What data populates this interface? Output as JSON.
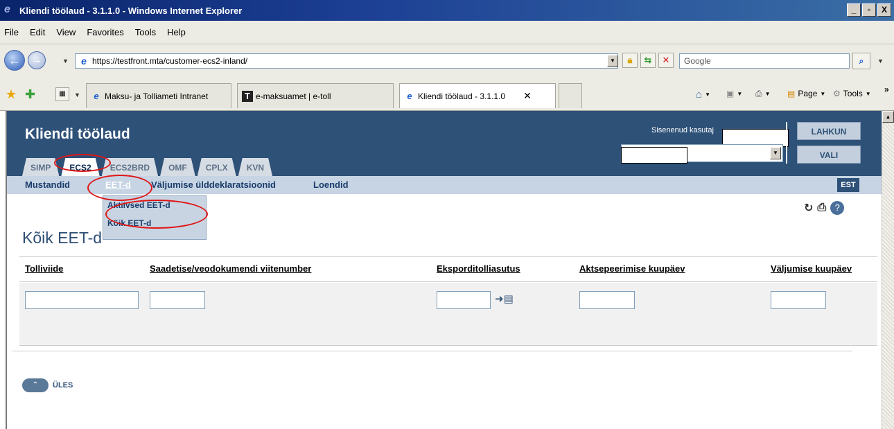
{
  "window": {
    "title": "Kliendi töölaud - 3.1.1.0 - Windows Internet Explorer",
    "buttons": [
      "_",
      "▫",
      "X"
    ]
  },
  "menu": [
    "File",
    "Edit",
    "View",
    "Favorites",
    "Tools",
    "Help"
  ],
  "address": {
    "url": "https://testfront.mta/customer-ecs2-inland/",
    "search_placeholder": "Google"
  },
  "tabs": [
    {
      "label": "Maksu- ja Tolliameti Intranet"
    },
    {
      "label": "e-maksuamet | e-toll"
    },
    {
      "label": "Kliendi töölaud - 3.1.1.0",
      "active": true
    }
  ],
  "commandbar": {
    "page": "Page",
    "tools": "Tools"
  },
  "app": {
    "title": "Kliendi töölaud",
    "user_label": "Sisenenud kasutaj",
    "system_tabs": [
      "SIMP",
      "ECS2",
      "ECS2BRD",
      "OMF",
      "CPLX",
      "KVN"
    ],
    "active_system_tab": "ECS2",
    "logout_label": "LAHKUN",
    "choose_label": "VALI",
    "language": "EST"
  },
  "subnav": [
    "Mustandid",
    "EET-d",
    "Väljumise ülddeklaratsioonid",
    "Loendid"
  ],
  "dropdown": [
    "Aktiivsed EET-d",
    "Kõik EET-d"
  ],
  "page": {
    "heading": "Kõik EET-d",
    "columns": [
      "Tolliviide",
      "Saadetise/veodokumendi viitenumber",
      "Eksporditolliasutus",
      "Aktsepeerimise kuupäev",
      "Väljumise kuupäev"
    ],
    "up_label": "ÜLES"
  },
  "colors": {
    "header": "#2e5178",
    "subnav": "#c6d4e4",
    "annotation": "#e01616"
  }
}
